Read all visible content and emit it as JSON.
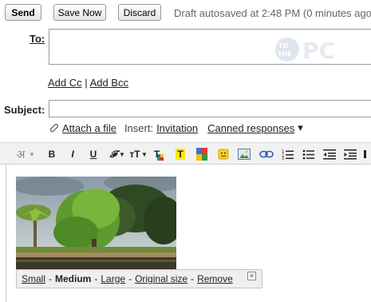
{
  "toolbar": {
    "send_label": "Send",
    "save_label": "Save Now",
    "discard_label": "Discard",
    "autosave_text": "Draft autosaved at 2:48 PM (0 minutes ago)"
  },
  "to": {
    "label": "To:",
    "value": ""
  },
  "recipients": {
    "add_cc": "Add Cc",
    "separator": "|",
    "add_bcc": "Add Bcc"
  },
  "subject": {
    "label": "Subject:",
    "value": ""
  },
  "attach": {
    "attach_label": "Attach a file",
    "insert_label": "Insert:",
    "invitation_label": "Invitation",
    "canned_label": "Canned responses",
    "canned_arrow": "▾"
  },
  "format_toolbar": {
    "input_tools_glyph": "अ",
    "bold": "B",
    "italic": "I",
    "underline": "U",
    "font": "𝓕",
    "size": "тT",
    "text_color": "T",
    "highlight": "T"
  },
  "image_sizes": {
    "small": "Small",
    "medium": "Medium",
    "large": "Large",
    "original": "Original size",
    "remove": "Remove",
    "dash": "-",
    "current": "medium"
  },
  "colors": {
    "accent": "#1a73e8",
    "toolbar_bg": "#f1f1f1",
    "size_bar_bg": "#efefef"
  }
}
